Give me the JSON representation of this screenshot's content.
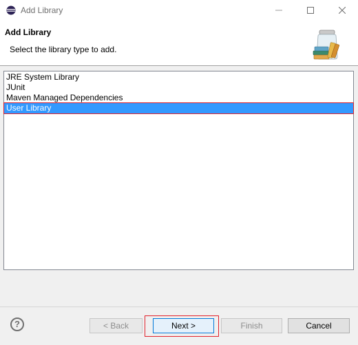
{
  "window": {
    "title": "Add Library"
  },
  "banner": {
    "title": "Add Library",
    "description": "Select the library type to add."
  },
  "library_types": [
    {
      "label": "JRE System Library",
      "selected": false
    },
    {
      "label": "JUnit",
      "selected": false
    },
    {
      "label": "Maven Managed Dependencies",
      "selected": false
    },
    {
      "label": "User Library",
      "selected": true
    }
  ],
  "buttons": {
    "back": "< Back",
    "next": "Next >",
    "finish": "Finish",
    "cancel": "Cancel",
    "help": "?"
  },
  "colors": {
    "selection": "#3399ff",
    "highlight_outline": "#e0202a"
  },
  "icons": [
    "eclipse-app-icon",
    "minimize-icon",
    "maximize-icon",
    "close-icon",
    "library-jar-icon",
    "help-icon"
  ]
}
